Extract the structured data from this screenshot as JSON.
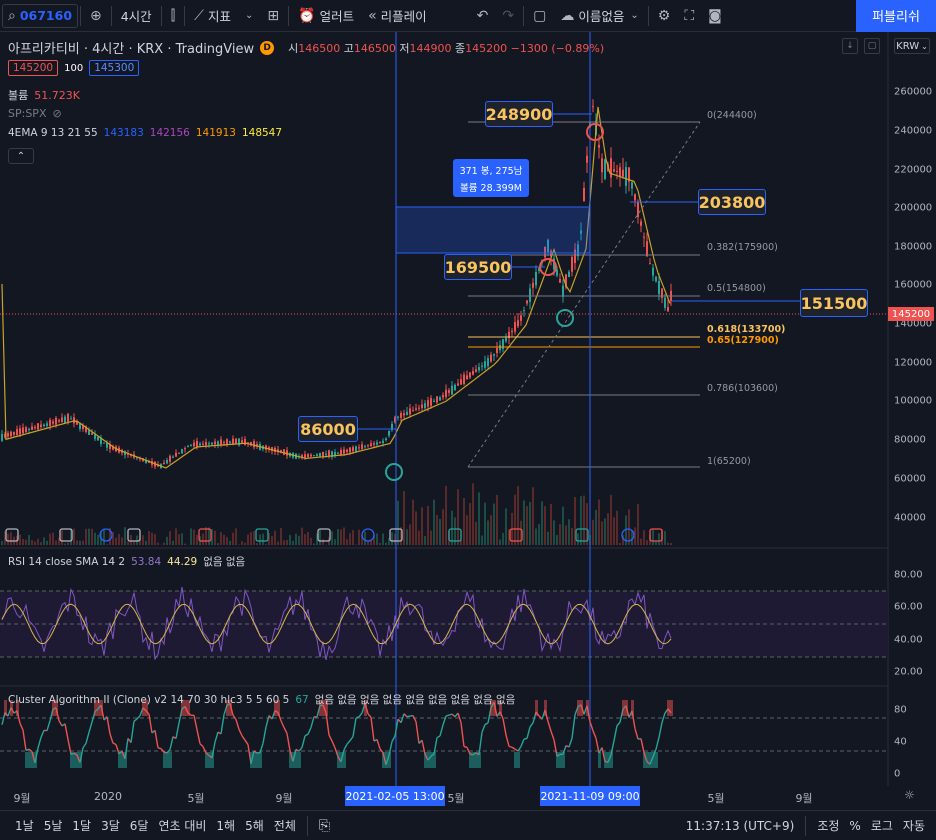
{
  "topbar": {
    "symbol_code": "067160",
    "interval": "4시간",
    "indicators_label": "지표",
    "alert_label": "얼러트",
    "replay_label": "리플레이",
    "layout_name": "이름없음",
    "publish_label": "퍼블리쉬"
  },
  "legend": {
    "title": "아프리카티비 · 4시간 · KRX · TradingView",
    "badge": "D",
    "ohlc": {
      "o_label": "시",
      "o": "146500",
      "h_label": "고",
      "h": "146500",
      "l_label": "저",
      "l": "144900",
      "c_label": "종",
      "c": "145200",
      "change": "−1300 (−0.89%)"
    },
    "bid": "145200",
    "spread": "100",
    "ask": "145300",
    "volume_label": "볼륨",
    "volume_value": "51.723K",
    "compare_symbol": "SP:SPX",
    "ema_label": "4EMA 9 13 21 55",
    "ema_values": [
      "143183",
      "142156",
      "141913",
      "148547"
    ],
    "currency": "KRW"
  },
  "annotations": {
    "label_248900": "248900",
    "label_203800": "203800",
    "label_169500": "169500",
    "label_86000": "86000",
    "label_151500": "151500",
    "range_bars": "371 봉, 275남",
    "range_volume": "볼륨 28.399M",
    "current_price": "145200"
  },
  "fib": [
    {
      "level": "0(244400)"
    },
    {
      "level": "0.382(175900)"
    },
    {
      "level": "0.5(154800)"
    },
    {
      "level": "0.618(133700)"
    },
    {
      "level": "0.65(127900)"
    },
    {
      "level": "0.786(103600)"
    },
    {
      "level": "1(65200)"
    }
  ],
  "price_axis": [
    "260000",
    "240000",
    "220000",
    "200000",
    "180000",
    "160000",
    "140000",
    "120000",
    "100000",
    "80000",
    "60000",
    "40000"
  ],
  "rsi": {
    "label": "RSI 14 close SMA 14 2",
    "v1": "53.84",
    "v2": "44.29",
    "extra": "없음 없음",
    "axis": [
      "80.00",
      "60.00",
      "40.00",
      "20.00"
    ]
  },
  "cluster": {
    "label": "Cluster Algorithm II (Clone) v2 14 70 30 hlc3 5 5 60 5",
    "value": "67",
    "extra": "없음 없음 없음 없음 없음 없음 없음 없음 없음",
    "axis": [
      "80",
      "40",
      "0"
    ]
  },
  "time_axis": {
    "ticks": [
      "9월",
      "2020",
      "5월",
      "9월",
      "5월",
      "5월",
      "9월"
    ],
    "cross1": "2021-02-05   13:00",
    "cross2": "2021-11-09   09:00"
  },
  "bottombar": {
    "ranges": [
      "1날",
      "5날",
      "1달",
      "3달",
      "6달",
      "연초 대비",
      "1해",
      "5해",
      "전체"
    ],
    "clock": "11:37:13 (UTC+9)",
    "adjust": "조정",
    "percent": "%",
    "log": "로그",
    "auto": "자동"
  },
  "colors": {
    "accent": "#2962ff",
    "up": "#26a69a",
    "down": "#ef5350",
    "label_text": "#f9c35d"
  }
}
